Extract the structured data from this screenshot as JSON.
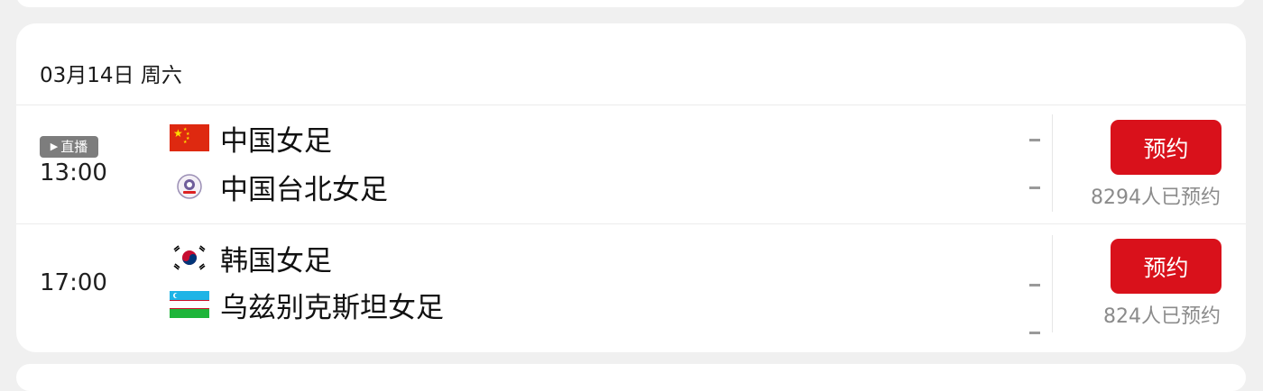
{
  "date_header": "03月14日 周六",
  "matches": [
    {
      "live_badge": "直播",
      "time": "13:00",
      "home": {
        "name": "中国女足",
        "flag": "china-flag-icon",
        "score": "-"
      },
      "away": {
        "name": "中国台北女足",
        "flag": "chinese-taipei-emblem-icon",
        "score": "-"
      },
      "reserve_label": "预约",
      "reserve_count": "8294人已预约"
    },
    {
      "time": "17:00",
      "home": {
        "name": "韩国女足",
        "flag": "south-korea-flag-icon",
        "score": "-"
      },
      "away": {
        "name": "乌兹别克斯坦女足",
        "flag": "uzbekistan-flag-icon",
        "score": "-"
      },
      "reserve_label": "预约",
      "reserve_count": "824人已预约"
    }
  ],
  "colors": {
    "accent_red": "#d9111b",
    "badge_gray": "#7d7d7d",
    "muted_text": "#8b8b8b"
  }
}
